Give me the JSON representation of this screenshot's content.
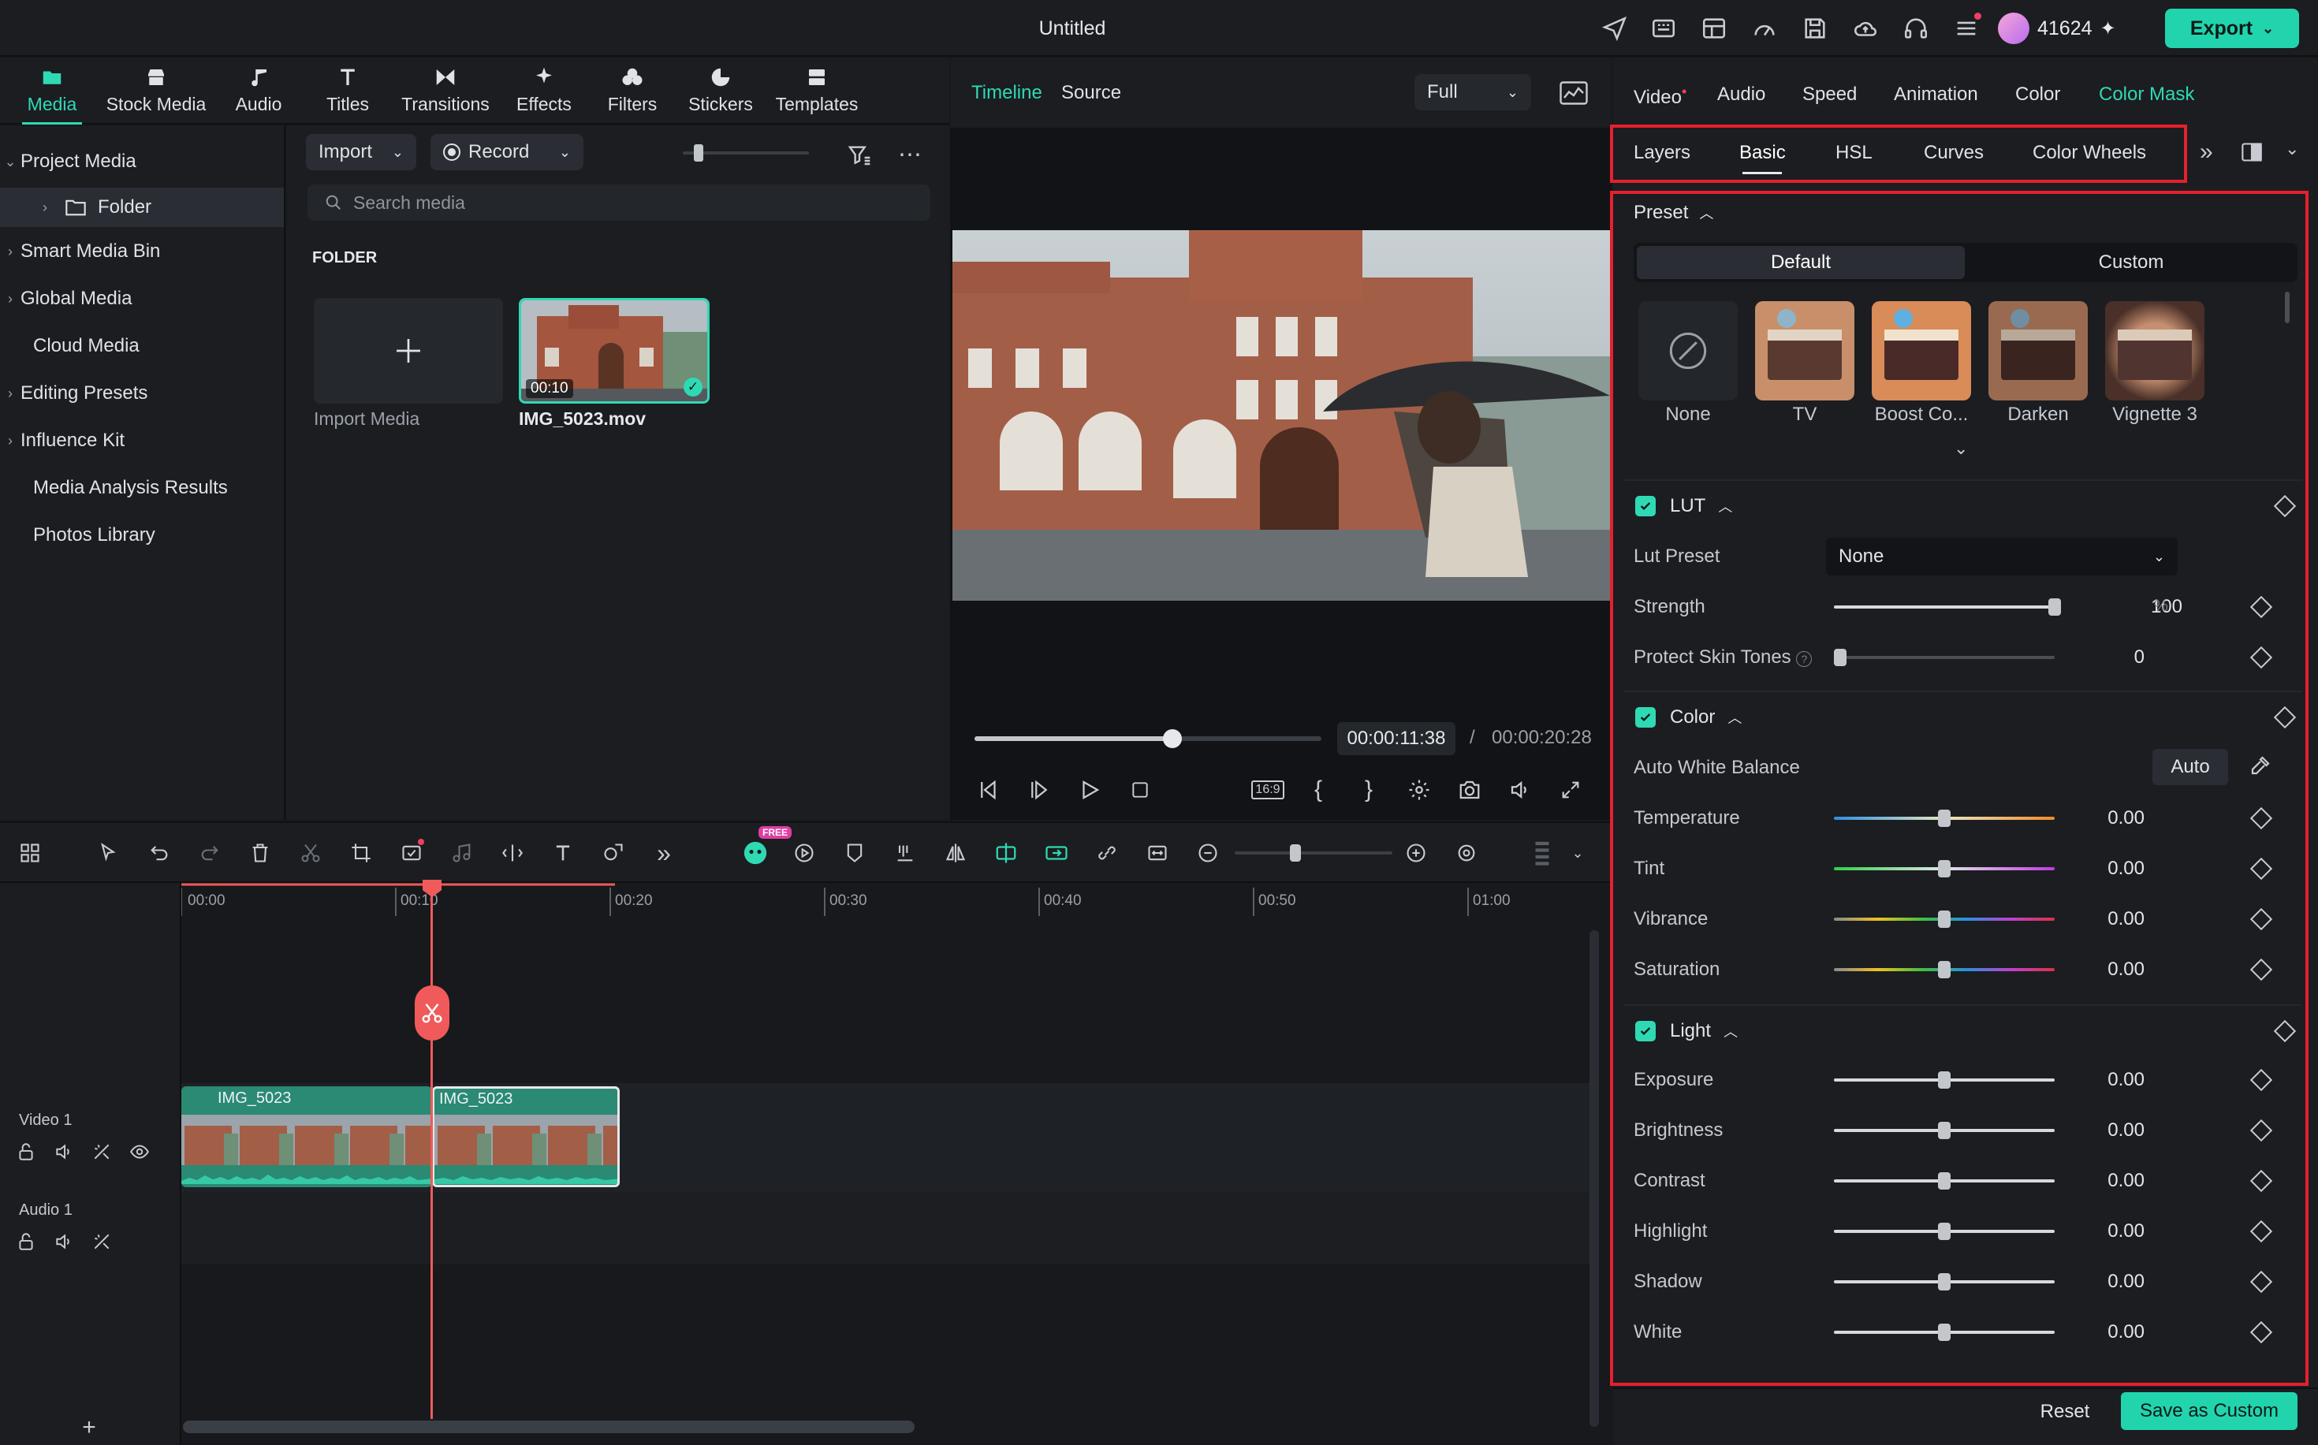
{
  "window": {
    "title": "Untitled",
    "credits": "41624",
    "export_label": "Export"
  },
  "modules": [
    {
      "label": "Media",
      "icon": "media-icon"
    },
    {
      "label": "Stock Media",
      "icon": "stock-media-icon"
    },
    {
      "label": "Audio",
      "icon": "music-note-icon"
    },
    {
      "label": "Titles",
      "icon": "titles-icon"
    },
    {
      "label": "Transitions",
      "icon": "transitions-icon"
    },
    {
      "label": "Effects",
      "icon": "effects-icon"
    },
    {
      "label": "Filters",
      "icon": "filters-icon"
    },
    {
      "label": "Stickers",
      "icon": "stickers-icon"
    },
    {
      "label": "Templates",
      "icon": "templates-icon"
    }
  ],
  "sidebar": {
    "items": [
      {
        "label": "Project Media",
        "expand": "down"
      },
      {
        "label": "Folder",
        "expand": "right"
      },
      {
        "label": "Smart Media Bin",
        "expand": "right"
      },
      {
        "label": "Global Media",
        "expand": "right"
      },
      {
        "label": "Cloud Media",
        "expand": ""
      },
      {
        "label": "Editing Presets",
        "expand": "right"
      },
      {
        "label": "Influence Kit",
        "expand": "right"
      },
      {
        "label": "Media Analysis Results",
        "expand": ""
      },
      {
        "label": "Photos Library",
        "expand": ""
      }
    ]
  },
  "media": {
    "import_label": "Import",
    "record_label": "Record",
    "search_placeholder": "Search media",
    "folder_heading": "FOLDER",
    "import_tile_label": "Import Media",
    "clip_name": "IMG_5023.mov",
    "clip_duration": "00:10"
  },
  "preview": {
    "tab_timeline": "Timeline",
    "tab_source": "Source",
    "quality": "Full",
    "current_time": "00:00:11:38",
    "separator": "/",
    "total_time": "00:00:20:28",
    "progress": 0.57,
    "aspect": "16:9"
  },
  "timeline": {
    "ruler": [
      "00:00",
      "00:10",
      "00:20",
      "00:30",
      "00:40",
      "00:50",
      "01:00"
    ],
    "video_track": "Video 1",
    "audio_track": "Audio 1",
    "clips": [
      "IMG_5023",
      "IMG_5023"
    ],
    "free_badge": "FREE",
    "colors": {
      "playhead": "#f05a5a",
      "clip": "#2a8a74",
      "accent": "#2fd9b4"
    }
  },
  "panel": {
    "tabs": [
      "Video",
      "Audio",
      "Speed",
      "Animation",
      "Color",
      "Color Mask"
    ],
    "subtabs": [
      "Layers",
      "Basic",
      "HSL",
      "Curves",
      "Color Wheels"
    ],
    "preset_label": "Preset",
    "preset_default": "Default",
    "preset_custom": "Custom",
    "presets": [
      "None",
      "TV",
      "Boost Co...",
      "Darken",
      "Vignette 3"
    ],
    "lut": {
      "title": "LUT",
      "lut_preset_label": "Lut Preset",
      "lut_preset_value": "None",
      "strength_label": "Strength",
      "strength_value": "100",
      "strength_unit": "%",
      "strength_level": 1.0,
      "skin_label": "Protect Skin Tones",
      "skin_value": "0",
      "skin_level": 0.0
    },
    "color": {
      "title": "Color",
      "awb_label": "Auto White Balance",
      "auto_label": "Auto",
      "rows": [
        {
          "label": "Temperature",
          "value": "0.00"
        },
        {
          "label": "Tint",
          "value": "0.00"
        },
        {
          "label": "Vibrance",
          "value": "0.00"
        },
        {
          "label": "Saturation",
          "value": "0.00"
        }
      ]
    },
    "light": {
      "title": "Light",
      "rows": [
        {
          "label": "Exposure",
          "value": "0.00"
        },
        {
          "label": "Brightness",
          "value": "0.00"
        },
        {
          "label": "Contrast",
          "value": "0.00"
        },
        {
          "label": "Highlight",
          "value": "0.00"
        },
        {
          "label": "Shadow",
          "value": "0.00"
        },
        {
          "label": "White",
          "value": "0.00"
        }
      ]
    },
    "reset_label": "Reset",
    "save_label": "Save as Custom"
  }
}
